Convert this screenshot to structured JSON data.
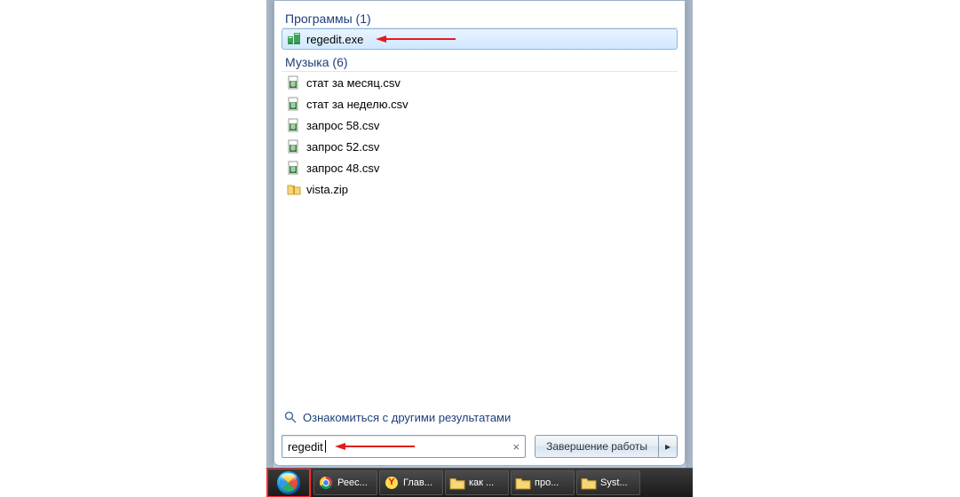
{
  "groups": [
    {
      "label": "Программы",
      "count": 1,
      "items": [
        {
          "name": "regedit.exe",
          "type": "regedit",
          "selected": true,
          "arrow": true
        }
      ]
    },
    {
      "label": "Музыка",
      "count": 6,
      "items": [
        {
          "name": "стат за месяц.csv",
          "type": "csv"
        },
        {
          "name": "стат за неделю.csv",
          "type": "csv"
        },
        {
          "name": "запрос 58.csv",
          "type": "csv"
        },
        {
          "name": "запрос 52.csv",
          "type": "csv"
        },
        {
          "name": "запрос 48.csv",
          "type": "csv"
        },
        {
          "name": "vista.zip",
          "type": "zip"
        }
      ]
    }
  ],
  "more_results_label": "Ознакомиться с другими результатами",
  "search": {
    "value": "regedit",
    "clear_glyph": "×"
  },
  "shutdown": {
    "label": "Завершение работы",
    "arrow_glyph": "▸"
  },
  "taskbar": [
    {
      "icon": "chrome",
      "label": "Реес..."
    },
    {
      "icon": "yandex",
      "label": "Глав..."
    },
    {
      "icon": "folder",
      "label": "как ..."
    },
    {
      "icon": "folder",
      "label": "про..."
    },
    {
      "icon": "folder",
      "label": "Syst..."
    }
  ]
}
